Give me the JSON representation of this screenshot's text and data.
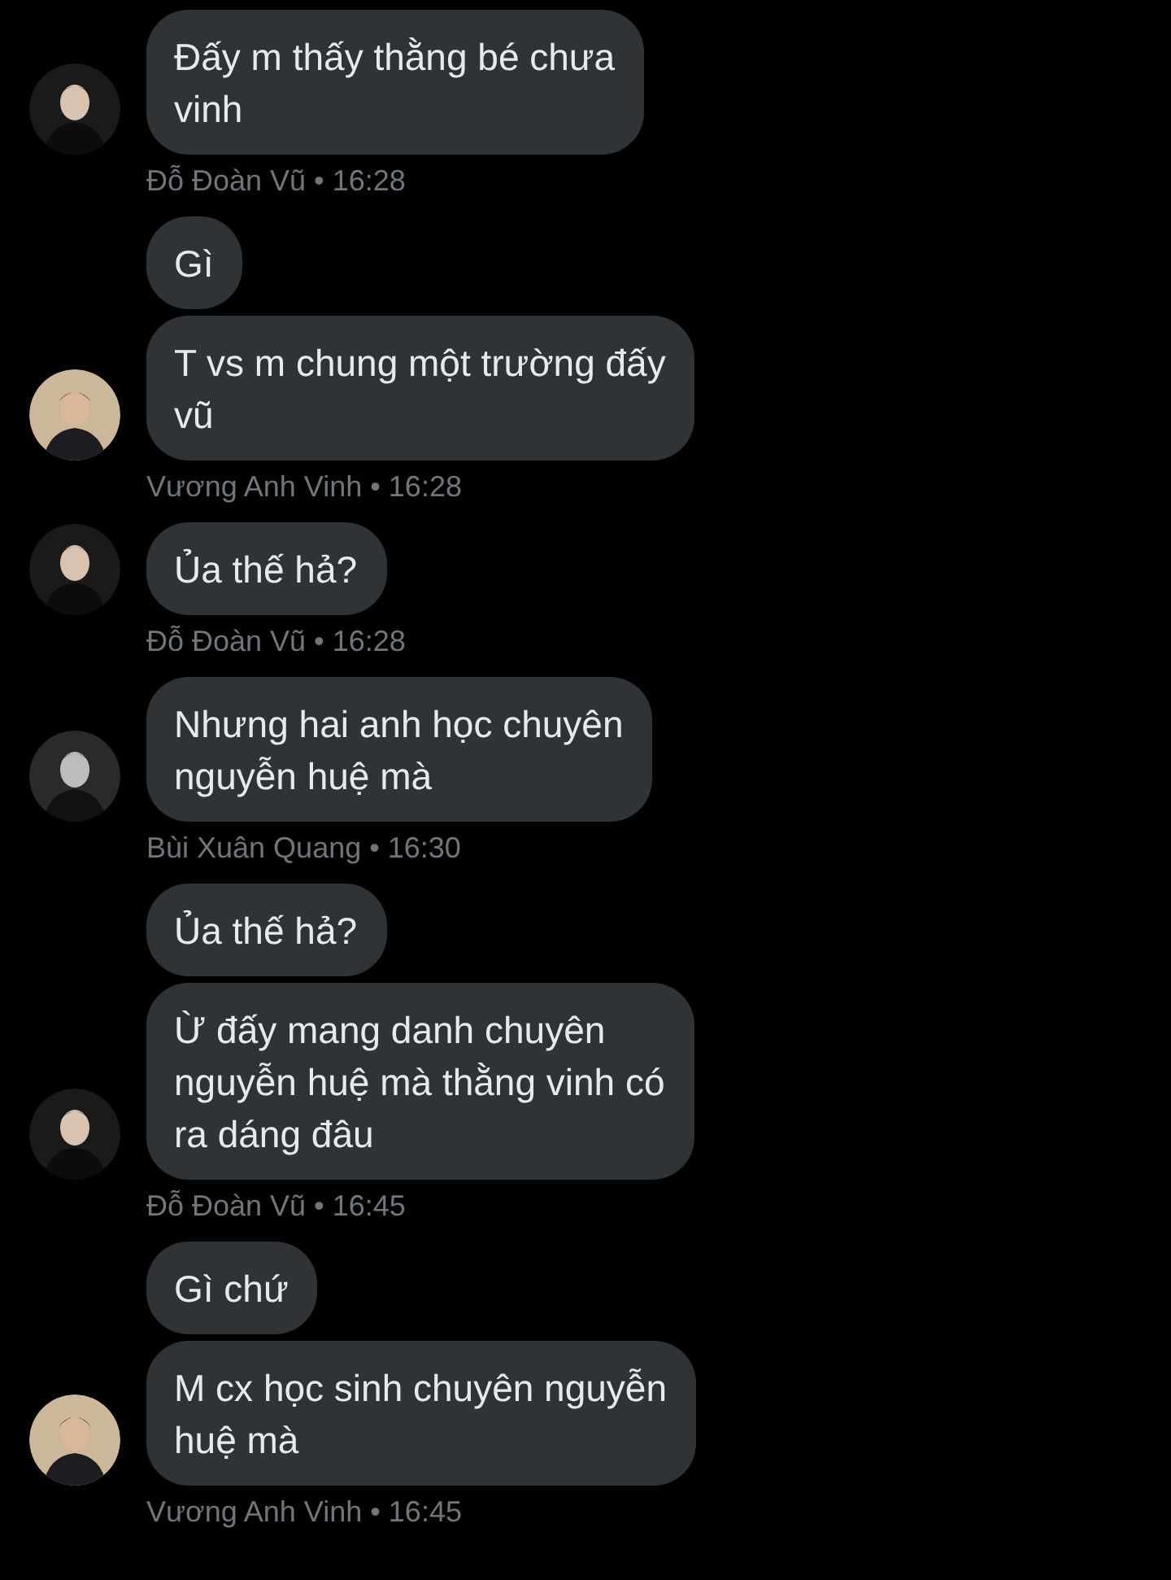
{
  "groups": [
    {
      "meta": "Đỗ Đoàn Vũ • 16:28",
      "messages": [
        "Đấy m thấy thằng bé chưa\nvinh"
      ]
    },
    {
      "meta": "Vương Anh Vinh • 16:28",
      "messages": [
        "Gì",
        "T vs m chung một trường đấy\nvũ"
      ]
    },
    {
      "meta": "Đỗ Đoàn Vũ • 16:28",
      "messages": [
        "Ủa thế hả?"
      ]
    },
    {
      "meta": "Bùi Xuân Quang • 16:30",
      "messages": [
        "Nhưng hai anh học chuyên\nnguyễn huệ mà"
      ]
    },
    {
      "meta": "Đỗ Đoàn Vũ • 16:45",
      "messages": [
        "Ủa thế hả?",
        "Ừ đấy mang danh chuyên\nnguyễn huệ mà thằng vinh có\nra dáng đâu"
      ]
    },
    {
      "meta": "Vương Anh Vinh • 16:45",
      "messages": [
        "Gì chứ",
        "M cx học sinh chuyên nguyễn\nhuệ mà"
      ]
    }
  ]
}
